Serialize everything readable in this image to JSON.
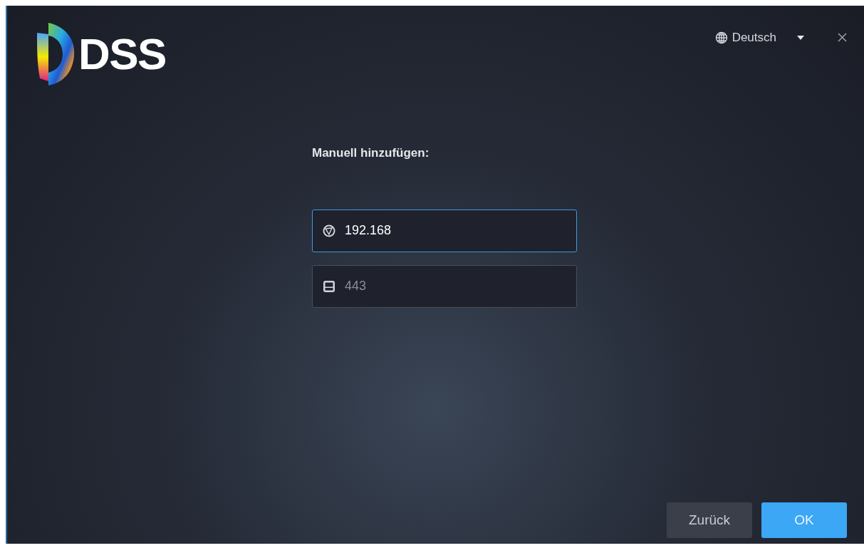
{
  "logo": {
    "text": "DSS"
  },
  "language": {
    "label": "Deutsch"
  },
  "form": {
    "heading": "Manuell hinzufügen:",
    "fields": [
      {
        "kind": "address",
        "value": "192.168",
        "focused": true
      },
      {
        "kind": "port",
        "placeholder": "443",
        "focused": false
      }
    ]
  },
  "buttons": [
    {
      "label": "Zurück",
      "kind": "secondary"
    },
    {
      "label": "OK",
      "kind": "primary"
    }
  ]
}
